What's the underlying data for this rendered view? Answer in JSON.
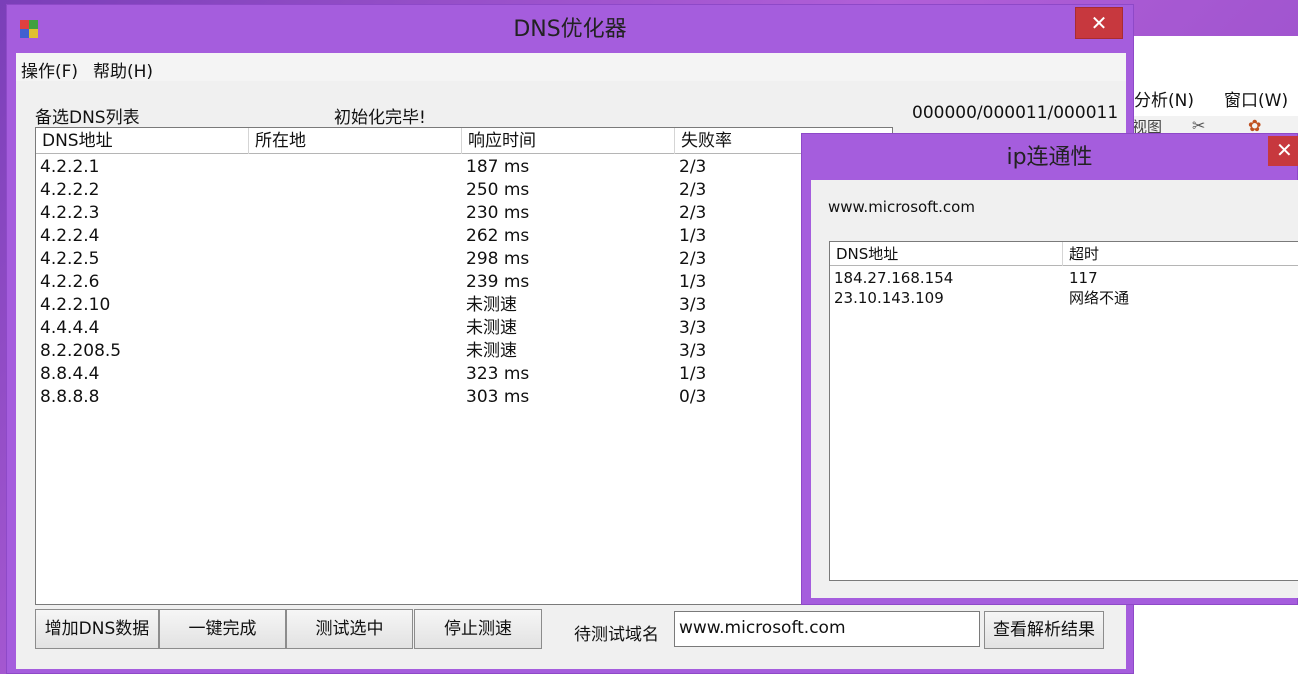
{
  "bg_app": {
    "menu": [
      "分析(N)",
      "窗口(W)"
    ],
    "toolbar_text": "视图"
  },
  "main": {
    "title": "DNS优化器",
    "close": "✕",
    "menu": [
      "操作(F)",
      "帮助(H)"
    ],
    "list_label": "备选DNS列表",
    "status": "初始化完毕!",
    "counter": "000000/000011/000011",
    "columns": [
      "DNS地址",
      "所在地",
      "响应时间",
      "失败率"
    ],
    "rows": [
      {
        "ip": "4.2.2.1",
        "loc": "",
        "time": "187 ms",
        "fail": "2/3"
      },
      {
        "ip": "4.2.2.2",
        "loc": "",
        "time": "250 ms",
        "fail": "2/3"
      },
      {
        "ip": "4.2.2.3",
        "loc": "",
        "time": "230 ms",
        "fail": "2/3"
      },
      {
        "ip": "4.2.2.4",
        "loc": "",
        "time": "262 ms",
        "fail": "1/3"
      },
      {
        "ip": "4.2.2.5",
        "loc": "",
        "time": "298 ms",
        "fail": "2/3"
      },
      {
        "ip": "4.2.2.6",
        "loc": "",
        "time": "239 ms",
        "fail": "1/3"
      },
      {
        "ip": "4.2.2.10",
        "loc": "",
        "time": "未测速",
        "fail": "3/3"
      },
      {
        "ip": "4.4.4.4",
        "loc": "",
        "time": "未测速",
        "fail": "3/3"
      },
      {
        "ip": "8.2.208.5",
        "loc": "",
        "time": "未测速",
        "fail": "3/3"
      },
      {
        "ip": "8.8.4.4",
        "loc": "",
        "time": "323 ms",
        "fail": "1/3"
      },
      {
        "ip": "8.8.8.8",
        "loc": "",
        "time": "303 ms",
        "fail": "0/3"
      }
    ],
    "buttons": {
      "add": "增加DNS数据",
      "one_click": "一键完成",
      "test_selected": "测试选中",
      "stop": "停止测速",
      "view_results": "查看解析结果"
    },
    "domain_label": "待测试域名",
    "domain_value": "www.microsoft.com"
  },
  "ip_window": {
    "title": "ip连通性",
    "close": "✕",
    "domain": "www.microsoft.com",
    "columns": [
      "DNS地址",
      "超时"
    ],
    "rows": [
      {
        "ip": "184.27.168.154",
        "timeout": "117"
      },
      {
        "ip": "23.10.143.109",
        "timeout": "网络不通"
      }
    ]
  },
  "colors": {
    "titlebar": "#a55ddd",
    "close_button": "#c7383e",
    "client": "#f0f0f0"
  }
}
